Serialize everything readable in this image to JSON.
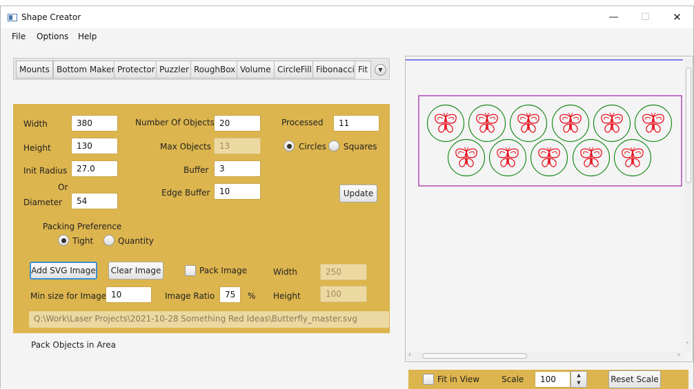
{
  "window": {
    "title": "Shape Creator",
    "minimize": "—",
    "maximize": "☐",
    "close": "✕"
  },
  "menu": [
    "File",
    "Options",
    "Help"
  ],
  "tabs": [
    "Mounts",
    "Bottom Maker",
    "Protector",
    "Puzzler",
    "RoughBox",
    "Volume",
    "CircleFill",
    "Fibonacci",
    "Fit"
  ],
  "active_tab": "Fit",
  "form": {
    "width_label": "Width",
    "width_value": "380",
    "height_label": "Height",
    "height_value": "130",
    "init_radius_label": "Init Radius",
    "init_radius_value": "27.0",
    "or_label": "Or",
    "diameter_label": "Diameter",
    "diameter_value": "54",
    "num_objects_label": "Number Of Objects",
    "num_objects_value": "20",
    "max_objects_label": "Max Objects",
    "max_objects_value": "13",
    "buffer_label": "Buffer",
    "buffer_value": "3",
    "edge_buffer_label": "Edge Buffer",
    "edge_buffer_value": "10",
    "processed_label": "Processed",
    "processed_value": "11",
    "circles_label": "Circles",
    "squares_label": "Squares",
    "shape_selected": "Circles",
    "update_label": "Update",
    "packing_pref_label": "Packing Preference",
    "tight_label": "Tight",
    "quantity_label": "Quantity",
    "packing_selected": "Tight",
    "add_svg_label": "Add SVG Image",
    "clear_image_label": "Clear Image",
    "pack_image_label": "Pack Image",
    "pack_image_checked": false,
    "img_width_label": "Width",
    "img_width_value": "250",
    "min_size_label": "Min size for Image",
    "min_size_value": "10",
    "image_ratio_label": "Image Ratio",
    "image_ratio_value": "75",
    "percent_label": "%",
    "img_height_label": "Height",
    "img_height_value": "100",
    "file_path": "Q:\\Work\\Laser Projects\\2021-10-28 Something Red Ideas\\Butterfly_master.svg"
  },
  "status_text": "Pack Objects in Area",
  "bottom": {
    "fit_in_view_label": "Fit in View",
    "fit_in_view_checked": false,
    "scale_label": "Scale",
    "scale_value": "100",
    "reset_scale_label": "Reset Scale"
  },
  "colors": {
    "panel_gold": "#ddb54e",
    "rect_stroke": "#b048b8",
    "circle_stroke": "#1a8a1a",
    "butterfly": "#e8101e"
  }
}
